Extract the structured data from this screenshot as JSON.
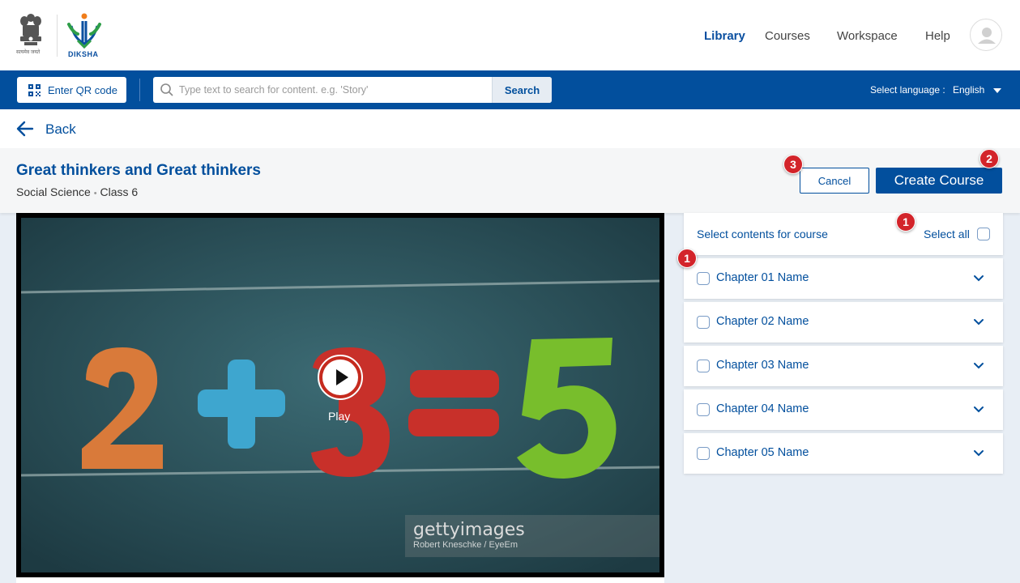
{
  "header": {
    "brand": "DIKSHA",
    "emblem_text": "सत्यमेव जयते",
    "nav": [
      {
        "label": "Library",
        "active": true
      },
      {
        "label": "Courses",
        "active": false
      },
      {
        "label": "Workspace",
        "active": false
      },
      {
        "label": "Help",
        "active": false
      }
    ],
    "avatar_icon": "user-icon"
  },
  "toolbar": {
    "qr_button_label": "Enter QR code",
    "search_placeholder": "Type text to search for content. e.g. 'Story'",
    "search_button_label": "Search",
    "language_label": "Select language :",
    "language_value": "English"
  },
  "back": {
    "label": "Back"
  },
  "content": {
    "title": "Great thinkers and Great thinkers",
    "subject": "Social Science",
    "separator": "•",
    "grade": "Class 6"
  },
  "actions": {
    "cancel_label": "Cancel",
    "create_label": "Create Course"
  },
  "video": {
    "play_label": "Play",
    "watermark_brand": "gettyimages",
    "watermark_credit": "Robert Kneschke / EyeEm"
  },
  "course_select": {
    "label": "Select contents for course",
    "select_all_label": "Select all",
    "chapters": [
      {
        "name": "Chapter 01 Name"
      },
      {
        "name": "Chapter 02 Name"
      },
      {
        "name": "Chapter 03 Name"
      },
      {
        "name": "Chapter 04 Name"
      },
      {
        "name": "Chapter 05 Name"
      }
    ]
  },
  "annotations": {
    "badge_select_all": "1",
    "badge_chapter": "1",
    "badge_create": "2",
    "badge_cancel": "3"
  },
  "colors": {
    "primary": "#024f9d",
    "badge": "#d3242a",
    "background": "#e8eef5"
  }
}
